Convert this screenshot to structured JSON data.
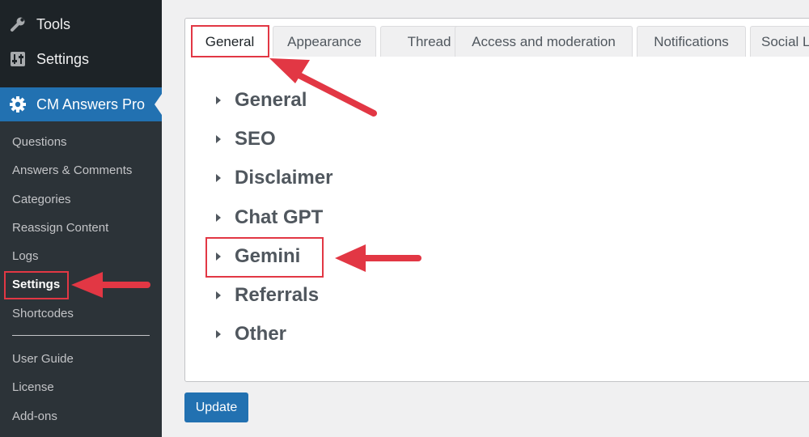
{
  "sidebar": {
    "tools_label": "Tools",
    "settings_label": "Settings",
    "plugin_label": "CM Answers Pro",
    "submenu": [
      {
        "label": "Questions"
      },
      {
        "label": "Answers & Comments"
      },
      {
        "label": "Categories"
      },
      {
        "label": "Reassign Content"
      },
      {
        "label": "Logs"
      },
      {
        "label": "Settings",
        "current": true
      },
      {
        "label": "Shortcodes"
      },
      {
        "label": "User Guide"
      },
      {
        "label": "License"
      },
      {
        "label": "Add-ons"
      }
    ]
  },
  "tabs": [
    {
      "label": "General",
      "active": true
    },
    {
      "label": "Appearance"
    },
    {
      "label": "Thread"
    },
    {
      "label": "Access and moderation"
    },
    {
      "label": "Notifications"
    },
    {
      "label": "Social L"
    }
  ],
  "sections": [
    "General",
    "SEO",
    "Disclaimer",
    "Chat GPT",
    "Gemini",
    "Referrals",
    "Other"
  ],
  "update_label": "Update",
  "icons": {
    "tools": "wrench-icon",
    "settings": "sliders-icon",
    "plugin": "gear-icon",
    "section_toggle": "triangle-right-icon"
  },
  "colors": {
    "sidebar_bg": "#1d2327",
    "submenu_bg": "#2c3338",
    "accent": "#2271b1",
    "annotation": "#e23744"
  }
}
